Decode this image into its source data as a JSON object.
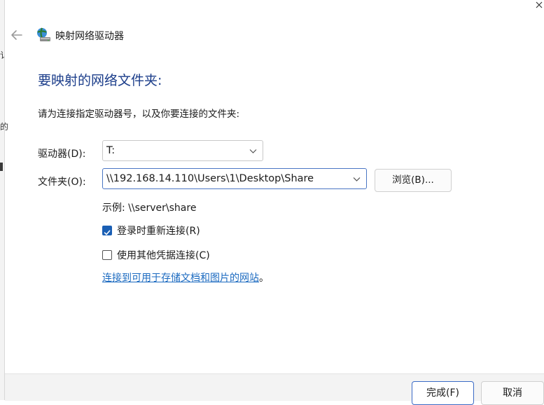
{
  "window": {
    "title": "映射网络驱动器",
    "back_icon": "arrow-left-icon",
    "app_icon": "network-drive-icon",
    "close_icon": "close-icon"
  },
  "background_fragments": [
    "讠",
    "的"
  ],
  "heading": "要映射的网络文件夹:",
  "instruction": "请为连接指定驱动器号，以及你要连接的文件夹:",
  "drive": {
    "label": "驱动器(D):",
    "value": "T:"
  },
  "folder": {
    "label": "文件夹(O):",
    "value": "\\\\192.168.14.110\\Users\\1\\Desktop\\Share"
  },
  "browse_label": "浏览(B)...",
  "example": "示例: \\\\server\\share",
  "reconnect": {
    "label": "登录时重新连接(R)",
    "checked": true
  },
  "other_credentials": {
    "label": "使用其他凭据连接(C)",
    "checked": false
  },
  "link": {
    "text": "连接到可用于存储文档和图片的网站",
    "suffix": "。"
  },
  "buttons": {
    "finish": "完成(F)",
    "cancel": "取消"
  },
  "colors": {
    "heading": "#1b3d8a",
    "link": "#1b6ac0",
    "checkbox_checked": "#1a5fb4",
    "primary_border": "#3b6bc6",
    "footer_bg": "#f3f3f3"
  }
}
